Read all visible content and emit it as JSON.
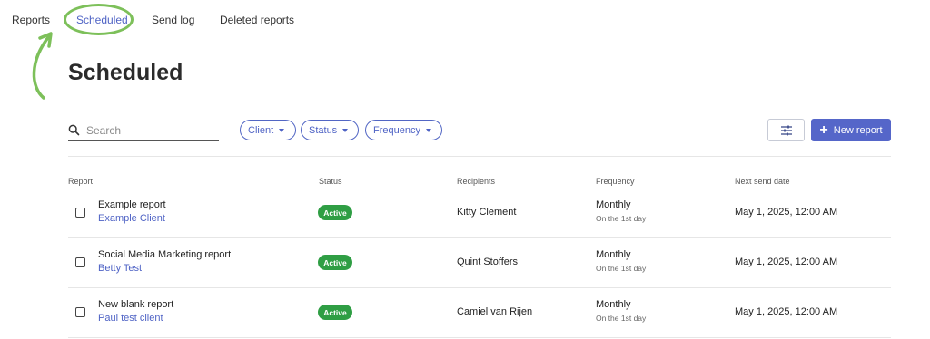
{
  "nav": {
    "tabs": [
      {
        "label": "Reports"
      },
      {
        "label": "Scheduled"
      },
      {
        "label": "Send log"
      },
      {
        "label": "Deleted reports"
      }
    ],
    "active_tab": "Scheduled"
  },
  "page": {
    "title": "Scheduled"
  },
  "toolbar": {
    "search_placeholder": "Search",
    "search_value": "",
    "filters": [
      {
        "label": "Client"
      },
      {
        "label": "Status"
      },
      {
        "label": "Frequency"
      }
    ],
    "settings_icon": "sliders-icon",
    "new_report_label": "New report"
  },
  "table": {
    "headers": [
      "Report",
      "Status",
      "Recipients",
      "Frequency",
      "Next send date"
    ],
    "rows": [
      {
        "name": "Example report",
        "client": "Example Client",
        "status": "Active",
        "recipients": "Kitty Clement",
        "frequency": "Monthly",
        "frequency_detail": "On the 1st day",
        "next_send": "May 1, 2025, 12:00 AM"
      },
      {
        "name": "Social Media Marketing report",
        "client": "Betty Test",
        "status": "Active",
        "recipients": "Quint Stoffers",
        "frequency": "Monthly",
        "frequency_detail": "On the 1st day",
        "next_send": "May 1, 2025, 12:00 AM"
      },
      {
        "name": "New blank report",
        "client": "Paul test client",
        "status": "Active",
        "recipients": "Camiel van Rijen",
        "frequency": "Monthly",
        "frequency_detail": "On the 1st day",
        "next_send": "May 1, 2025, 12:00 AM"
      }
    ]
  },
  "colors": {
    "accent": "#4f63c5",
    "primary_button": "#5566c9",
    "active_badge": "#2f9e44",
    "annotation": "#7dc05a"
  }
}
